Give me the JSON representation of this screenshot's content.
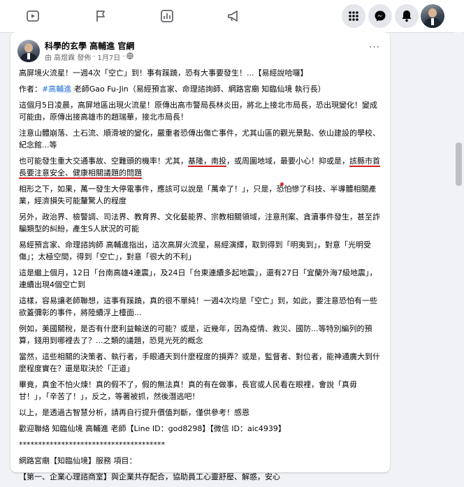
{
  "nav": {
    "icons": [
      "watch-icon",
      "flag-icon",
      "chart-icon",
      "megaphone-icon"
    ],
    "right_icons": [
      "menu-grid-icon",
      "messenger-icon",
      "bell-icon",
      "profile-avatar"
    ]
  },
  "post": {
    "author": "科學的玄學 高輔進 官網",
    "meta_by": "由 高煜霖 發佈",
    "meta_dot": "·",
    "meta_date": "1月7日",
    "meta_dot2": "·",
    "more_label": "···",
    "paragraphs": [
      "高屏境火流星！一週4次「空亡」到！事有蹊蹺，恐有大事要發生！...【易經說哈囉】",
      "這個月5日凌晨，高屏地區出現火流星！原傳出高市警局長林炎田，將北上接北市局長，恐出現變化！變成可能由，原傳出接高雄市的趙瑞華，接北市局長！",
      "注意山體崩落、土石流、順滑坡的變化，嚴重者恐傳出傷亡事件，尤其山區的觀光景點、依山建設的學校、紀念館...等",
      "相形之下，如果，萬一發生大停電事件，應該可以說是「萬幸了！」，只是，恐怕慘了科技、半導體相關產業，經濟損失可能釐驚人的程度",
      "另外，政治界、檢警調、司法界、教育界、文化藝能界、宗教相關領域，注意刑案、貪瀆事件發生，甚至詐騙類型的糾紛，產生S人狀況的可能",
      "易經預言家、命理諮詢師 高輔進指出，這次高屏火流星，易經演繹，取到得到「明夷到」，對意「光明受傷」；太極空間，得到「空亡」，對意「很大的不利」",
      "這是繼上個月，12日「台南高雄4連震」，及24日「台東連續多起地震」，還有27日「宜蘭外海7級地震」，連續出現4個空亡到",
      "這樣，容易讓老師聯想，這事有蹊蹺，真的很不單純！一週4次均是「空亡」到，如此，要注意恐怕有一些欲蓋彌彰的事件，將陸續浮上檯面...",
      "例如，美國關稅，是否有什麼利益輸送的可能？或是，近幾年，因為疫情、救災、國防...等特別編列的預算，錢用到哪裡去了？...之類的議題，恐見光死的概念",
      "當然，這些相關的決策者、執行者，手眼通天到什麼程度的損弄？或是，監督者、對位者，能神通廣大到什麼程度實在？還是取決於「正道」",
      "畢竟，真金不怕火煉！真的假不了，假的無法真！真的有在做事，長官或人民看在眼裡，會說「真毋甘！」，「辛苦了！」，反之，等著被抓，然後潛逃吧！",
      "以上，是透過古智慧分析，請再自行提升價值判斷，僅供參考！感恩",
      "歡迎聯絡 知臨仙境 高輔進 老師【Line ID：god8298】【微信 ID：aic4939】",
      "**************************************",
      "網路宮廟【知臨仙境】服務 項目：",
      "【第一、企業心理諮商室】與企業共存配合，協助員工心靈舒壓、解惑，安心"
    ],
    "author_line": {
      "prefix": "作者：",
      "hashtag": "#高輔進",
      "suffix": " 老師Gao Fu-Jin（易經預言家、命理諮詢師、網路宮廟 知臨仙境 執行長）"
    },
    "traffic_para": {
      "part1": "也可能發生重大交通事故、空難頭的機率！尤其，",
      "part2": "基隆，南投",
      "part3": "，或周圍地域，最要小心！抑或是，",
      "part4": "該縣市首長要注意安全、健康相關議題的問題"
    }
  },
  "colors": {
    "accent_red": "#d31e25",
    "link_blue": "#216fdb",
    "background": "#f0f2f5"
  }
}
